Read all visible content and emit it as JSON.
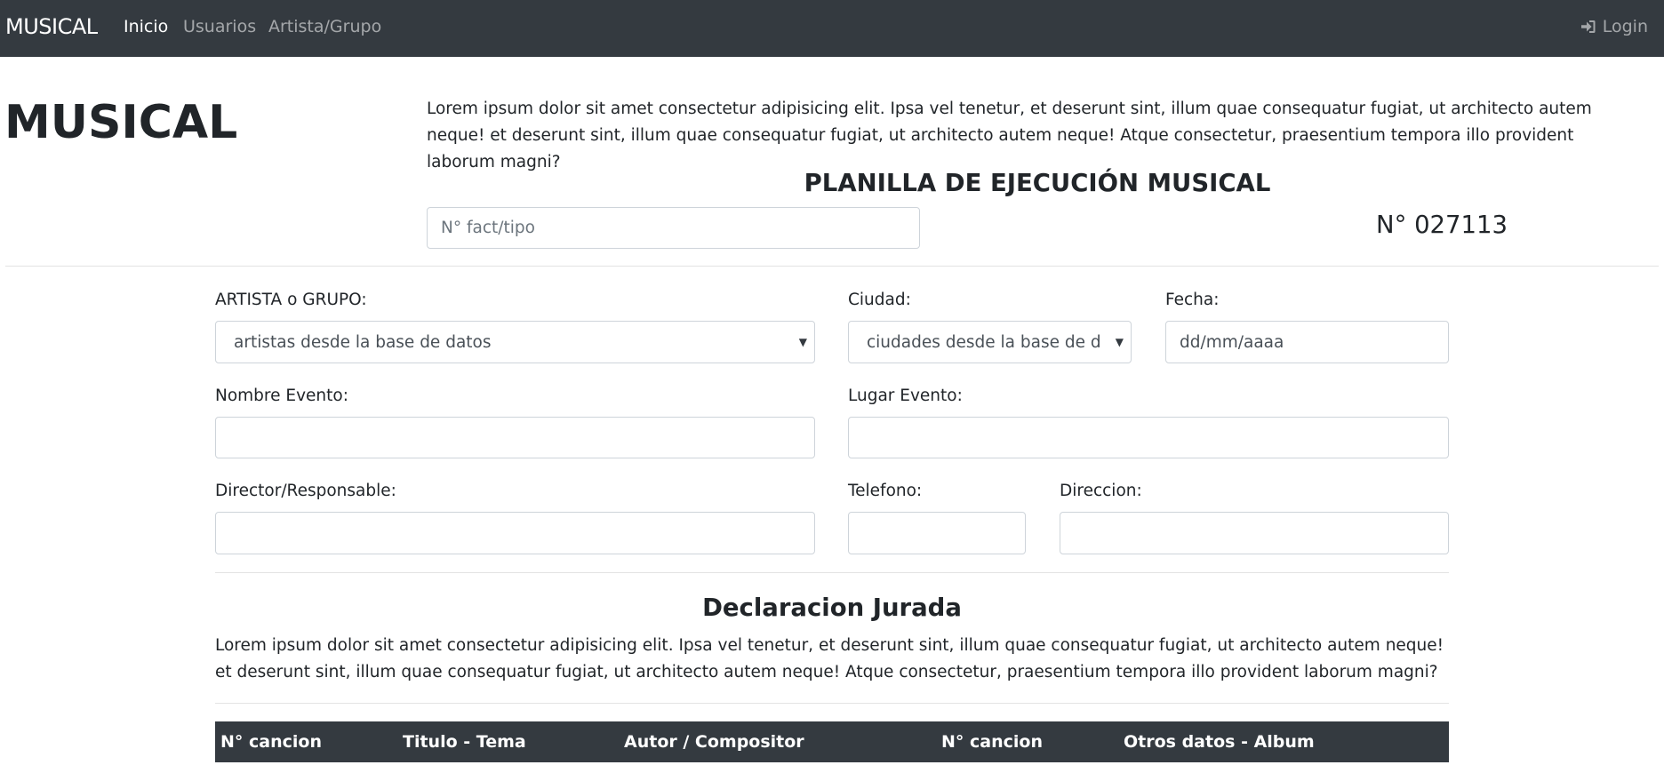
{
  "navbar": {
    "brand": "MUSICAL",
    "links": [
      "Inicio",
      "Usuarios",
      "Artista/Grupo"
    ],
    "login": "Login"
  },
  "header": {
    "title": "MUSICAL",
    "intro": "Lorem ipsum dolor sit amet consectetur adipisicing elit. Ipsa vel tenetur, et deserunt sint, illum quae consequatur fugiat, ut architecto autem neque! et deserunt sint, illum quae consequatur fugiat, ut architecto autem neque! Atque consectetur, praesentium tempora illo provident laborum magni?",
    "planilla_title": "PLANILLA DE EJECUCIÓN MUSICAL",
    "factura_placeholder": "N° fact/tipo",
    "numero": "N° 027113"
  },
  "form": {
    "artista_label": "ARTISTA o GRUPO:",
    "artista_value": "artistas desde la base de datos",
    "ciudad_label": "Ciudad:",
    "ciudad_value": "ciudades desde la base de datos",
    "fecha_label": "Fecha:",
    "fecha_value": "dd/mm/aaaa",
    "nombre_evento_label": "Nombre Evento:",
    "lugar_evento_label": "Lugar Evento:",
    "director_label": "Director/Responsable:",
    "telefono_label": "Telefono:",
    "direccion_label": "Direccion:"
  },
  "declaracion": {
    "title": "Declaracion Jurada",
    "text": "Lorem ipsum dolor sit amet consectetur adipisicing elit. Ipsa vel tenetur, et deserunt sint, illum quae consequatur fugiat, ut architecto autem neque! et deserunt sint, illum quae consequatur fugiat, ut architecto autem neque! Atque consectetur, praesentium tempora illo provident laborum magni?"
  },
  "table": {
    "headers": [
      "N° cancion",
      "Titulo - Tema",
      "Autor / Compositor",
      "N° cancion",
      "Otros datos - Album"
    ]
  },
  "icons": {
    "login": "sign-in-icon",
    "select_caret": "caret-down-icon"
  },
  "colors": {
    "navbar": "#343a40",
    "table_header": "#343a40"
  }
}
